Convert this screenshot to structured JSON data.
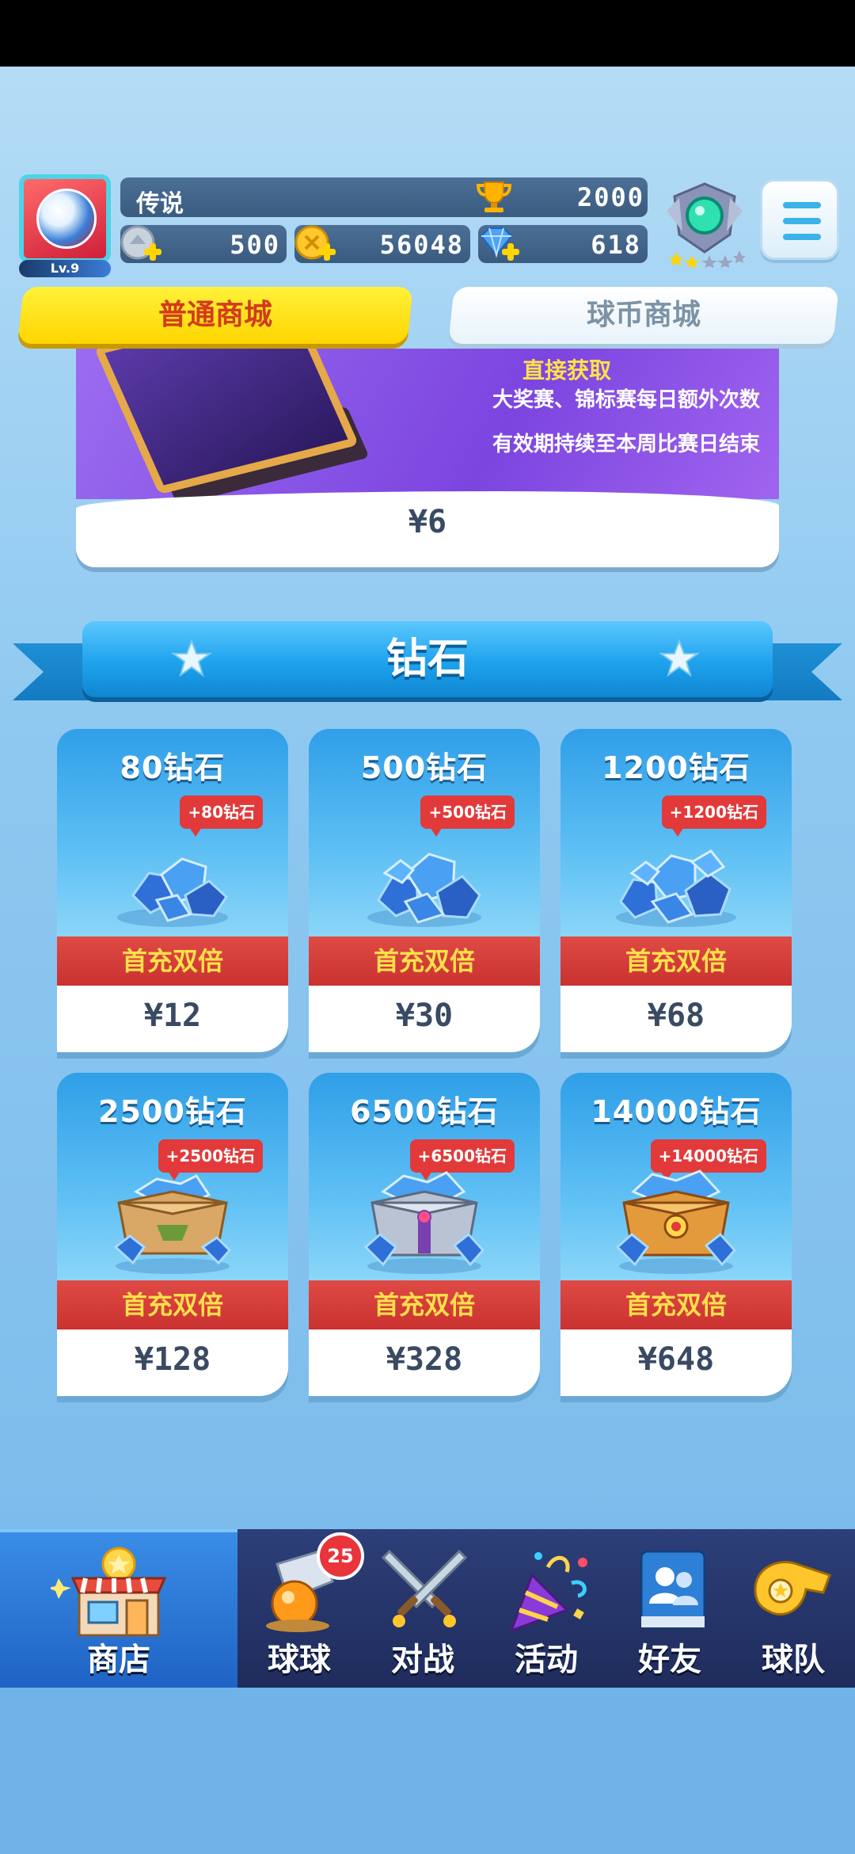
{
  "player": {
    "name": "传说",
    "level": "Lv.9",
    "trophies": "2000"
  },
  "resources": {
    "stamina": "500",
    "coins": "56048",
    "diamonds": "618"
  },
  "tabs": {
    "normal_shop": "普通商城",
    "ball_coin_shop": "球币商城"
  },
  "promo": {
    "title": "直接获取",
    "line1": "大奖赛、锦标赛每日额外次数",
    "line2": "有效期持续至本周比赛日结束",
    "price": "¥6"
  },
  "section": {
    "title": "钻石"
  },
  "packs": [
    {
      "title": "80钻石",
      "bonus": "+80钻石",
      "band": "首充双倍",
      "price": "¥12"
    },
    {
      "title": "500钻石",
      "bonus": "+500钻石",
      "band": "首充双倍",
      "price": "¥30"
    },
    {
      "title": "1200钻石",
      "bonus": "+1200钻石",
      "band": "首充双倍",
      "price": "¥68"
    },
    {
      "title": "2500钻石",
      "bonus": "+2500钻石",
      "band": "首充双倍",
      "price": "¥128"
    },
    {
      "title": "6500钻石",
      "bonus": "+6500钻石",
      "band": "首充双倍",
      "price": "¥328"
    },
    {
      "title": "14000钻石",
      "bonus": "+14000钻石",
      "band": "首充双倍",
      "price": "¥648"
    }
  ],
  "nav": {
    "items": [
      {
        "label": "商店",
        "icon": "shop-icon"
      },
      {
        "label": "球球",
        "icon": "balls-icon",
        "badge": "25"
      },
      {
        "label": "对战",
        "icon": "swords-icon"
      },
      {
        "label": "活动",
        "icon": "party-popper-icon"
      },
      {
        "label": "好友",
        "icon": "friends-book-icon"
      },
      {
        "label": "球队",
        "icon": "whistle-icon"
      }
    ]
  },
  "colors": {
    "accent_yellow": "#ffd500",
    "card_blue": "#2f9fe8",
    "band_red": "#c9322f",
    "nav_bg": "#1f2c5c"
  }
}
